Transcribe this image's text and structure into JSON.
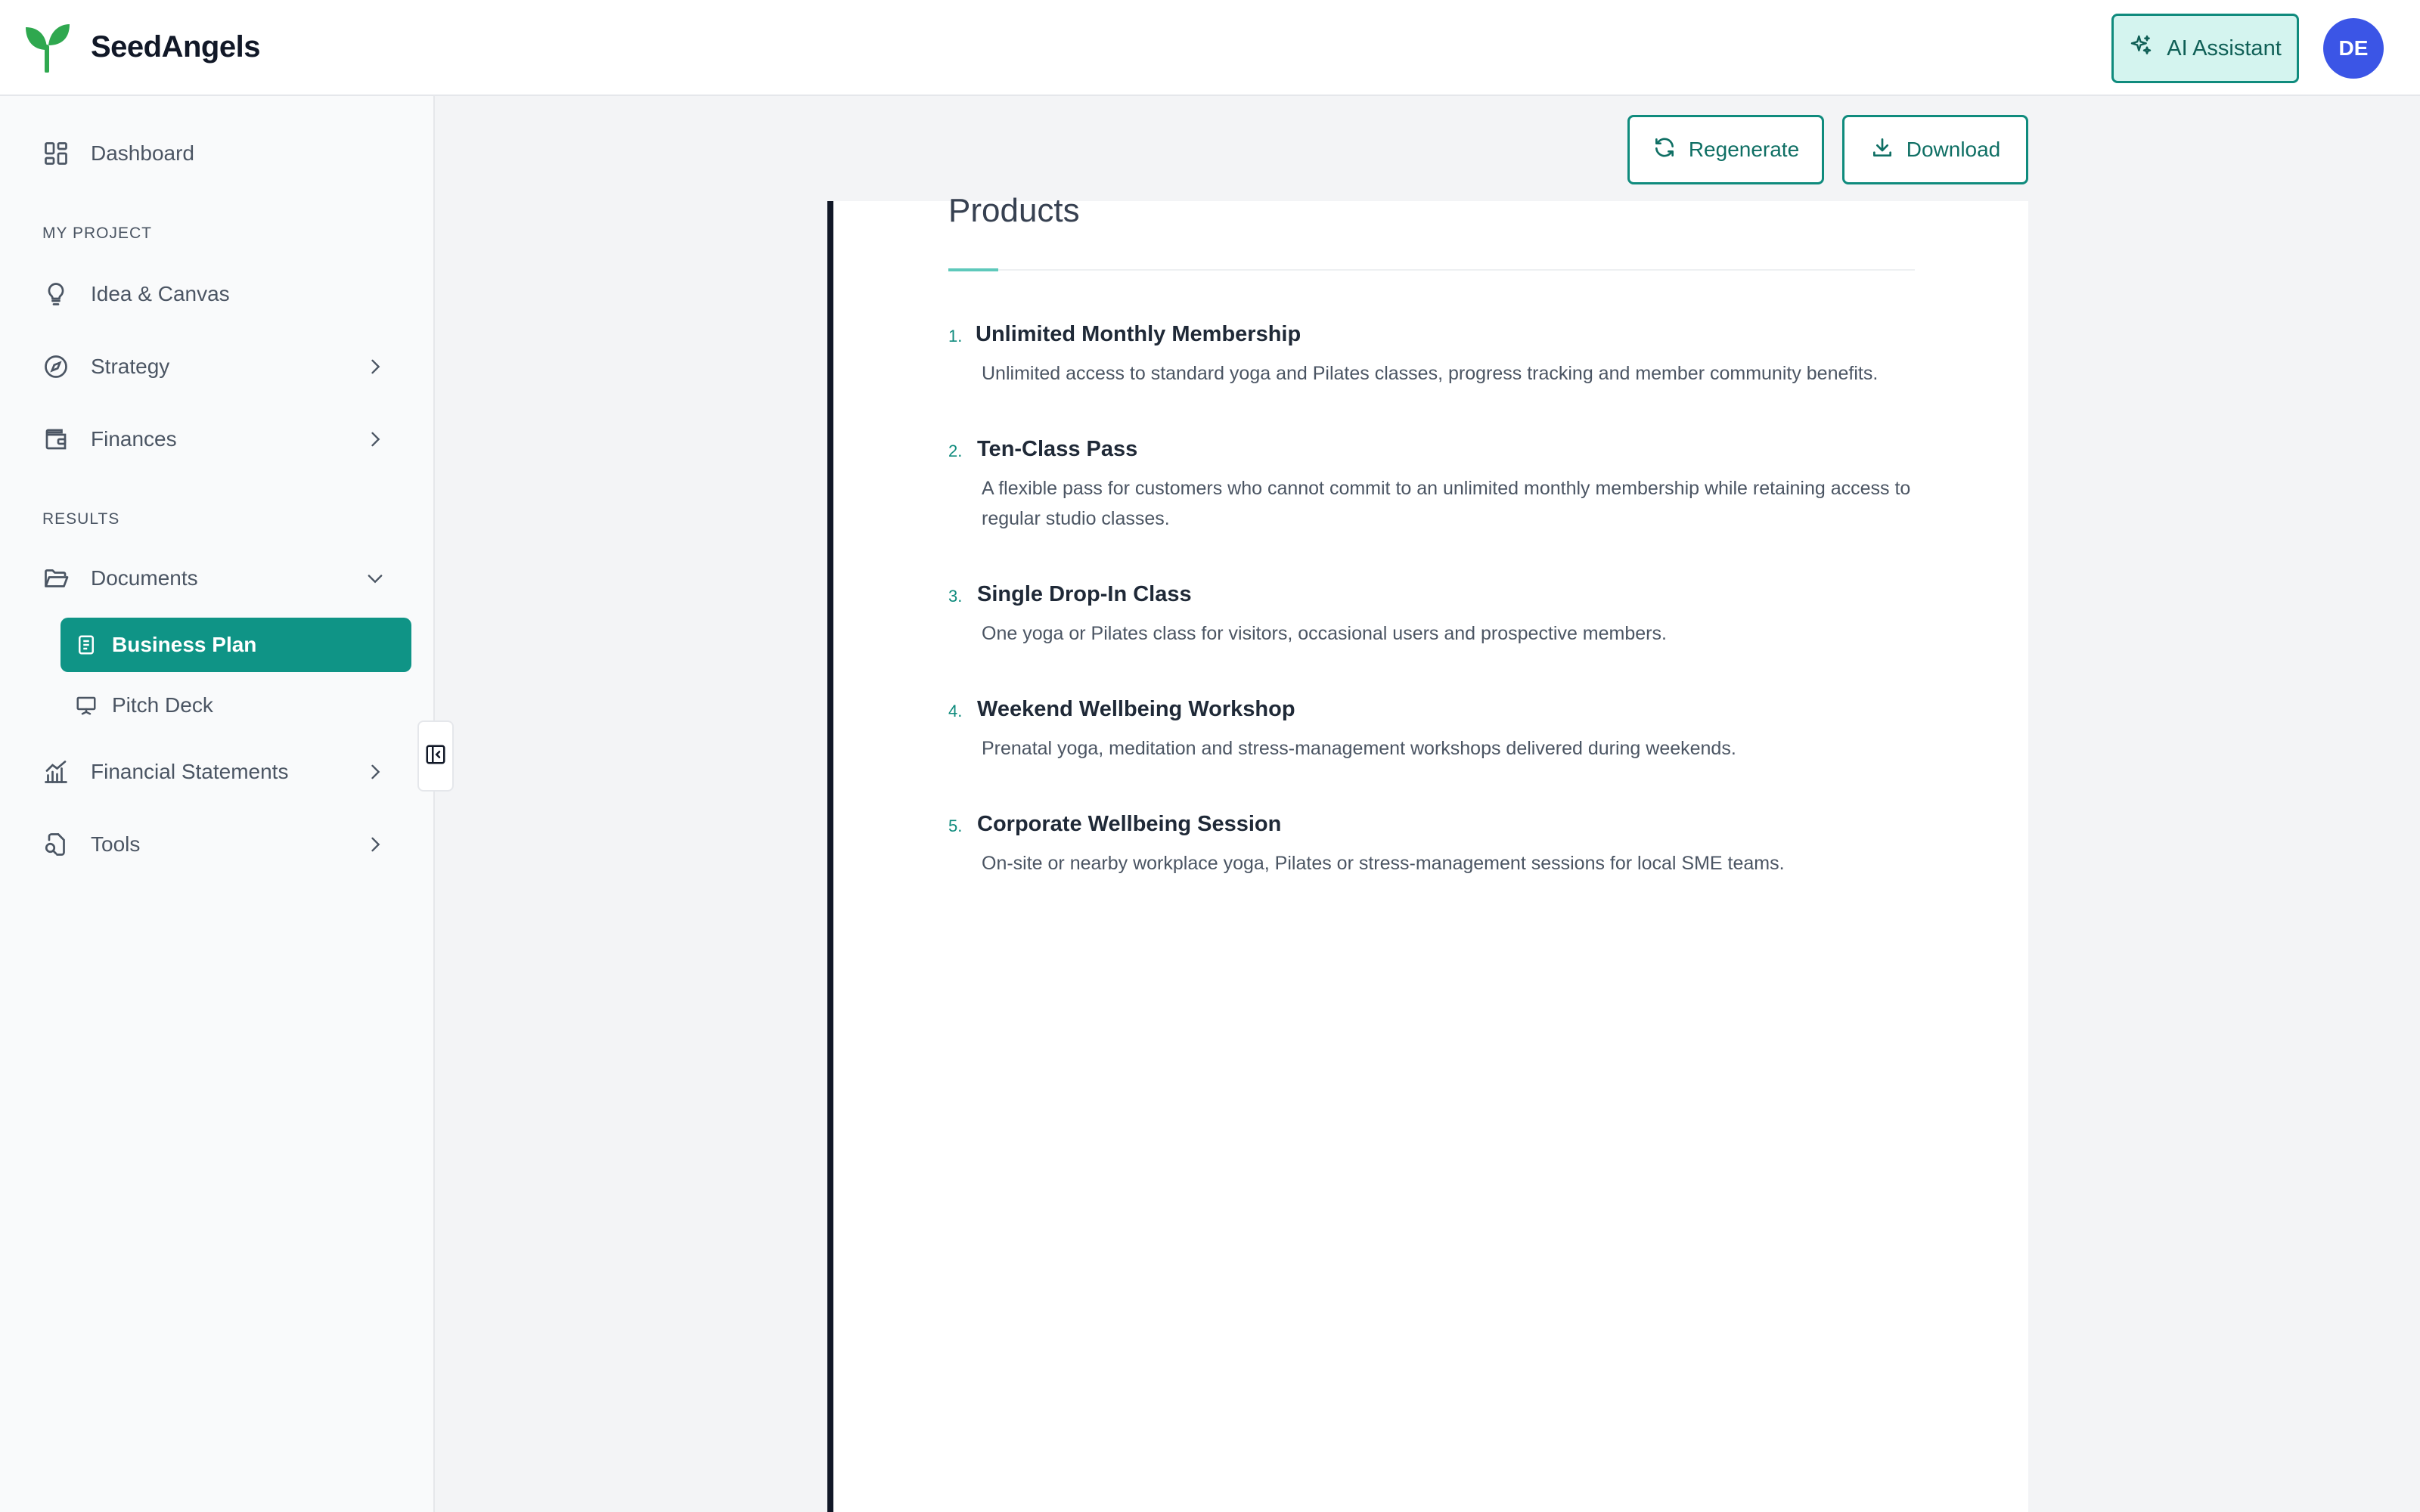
{
  "app": {
    "brand": "SeedAngels"
  },
  "header": {
    "ai_assistant_label": "AI Assistant",
    "avatar_initials": "DE"
  },
  "sidebar": {
    "dashboard": "Dashboard",
    "section_my_project": "MY PROJECT",
    "idea_canvas": "Idea & Canvas",
    "strategy": "Strategy",
    "finances": "Finances",
    "section_results": "RESULTS",
    "documents": "Documents",
    "documents_children": {
      "business_plan": "Business Plan",
      "pitch_deck": "Pitch Deck"
    },
    "financial_statements": "Financial Statements",
    "tools": "Tools"
  },
  "toolbar": {
    "regenerate_label": "Regenerate",
    "download_label": "Download"
  },
  "document": {
    "heading": "Products",
    "products": [
      {
        "num": "1.",
        "title": "Unlimited Monthly Membership",
        "desc": "Unlimited access to standard yoga and Pilates classes, progress tracking and member community benefits."
      },
      {
        "num": "2.",
        "title": "Ten-Class Pass",
        "desc": "A flexible pass for customers who cannot commit to an unlimited monthly membership while retaining access to regular studio classes."
      },
      {
        "num": "3.",
        "title": "Single Drop-In Class",
        "desc": "One yoga or Pilates class for visitors, occasional users and prospective members."
      },
      {
        "num": "4.",
        "title": "Weekend Wellbeing Workshop",
        "desc": "Prenatal yoga, meditation and stress-management workshops delivered during weekends."
      },
      {
        "num": "5.",
        "title": "Corporate Wellbeing Session",
        "desc": "On-site or nearby workplace yoga, Pilates or stress-management sessions for local SME teams."
      }
    ]
  },
  "colors": {
    "accent": "#0f9486",
    "accent_light": "#d4f4ef",
    "avatar_bg": "#3b55e6",
    "logo_green": "#2fa84f"
  },
  "icons": [
    "sparkles-icon",
    "dashboard-icon",
    "lightbulb-icon",
    "compass-icon",
    "wallet-icon",
    "folder-open-icon",
    "document-icon",
    "presentation-icon",
    "chart-icon",
    "tools-icon",
    "chevron-right-icon",
    "chevron-down-icon",
    "refresh-icon",
    "download-icon",
    "sidebar-collapse-icon"
  ]
}
